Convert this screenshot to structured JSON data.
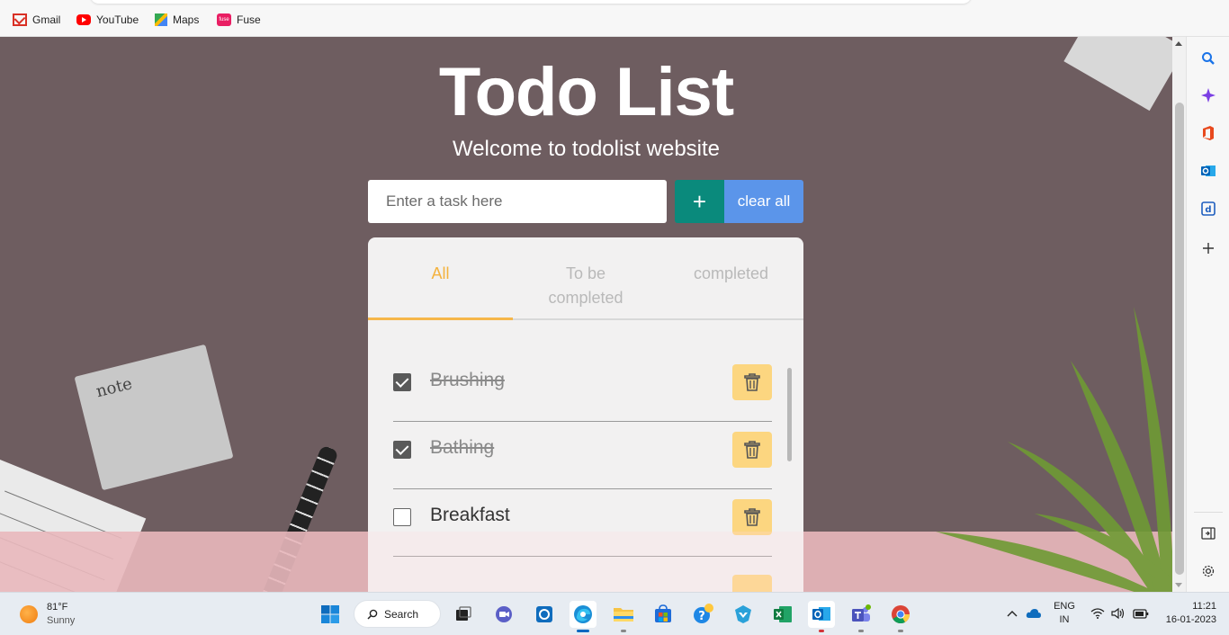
{
  "bookmarks": [
    {
      "label": "Gmail",
      "icon": "gmail-icon"
    },
    {
      "label": "YouTube",
      "icon": "youtube-icon"
    },
    {
      "label": "Maps",
      "icon": "maps-icon"
    },
    {
      "label": "Fuse",
      "icon": "fuse-icon"
    }
  ],
  "header": {
    "title": "Todo List",
    "subtitle": "Welcome to todolist website"
  },
  "input": {
    "placeholder": "Enter a task here",
    "value": "",
    "add_label": "+",
    "clear_label": "clear all"
  },
  "tabs": [
    {
      "label": "All",
      "active": true
    },
    {
      "label": "To be completed",
      "active": false
    },
    {
      "label": "completed",
      "active": false
    }
  ],
  "tasks": [
    {
      "text": "Brushing",
      "completed": true
    },
    {
      "text": "Bathing",
      "completed": true
    },
    {
      "text": "Breakfast",
      "completed": false
    }
  ],
  "taskbar": {
    "weather_temp": "81°F",
    "weather_cond": "Sunny",
    "search_label": "Search",
    "lang_top": "ENG",
    "lang_bottom": "IN",
    "time": "11:21",
    "date": "16-01-2023"
  },
  "colors": {
    "accent_tab": "#f4b23e",
    "add_button": "#0a8a7c",
    "clear_button": "#5b95ea",
    "trash_button": "#fcd680"
  }
}
